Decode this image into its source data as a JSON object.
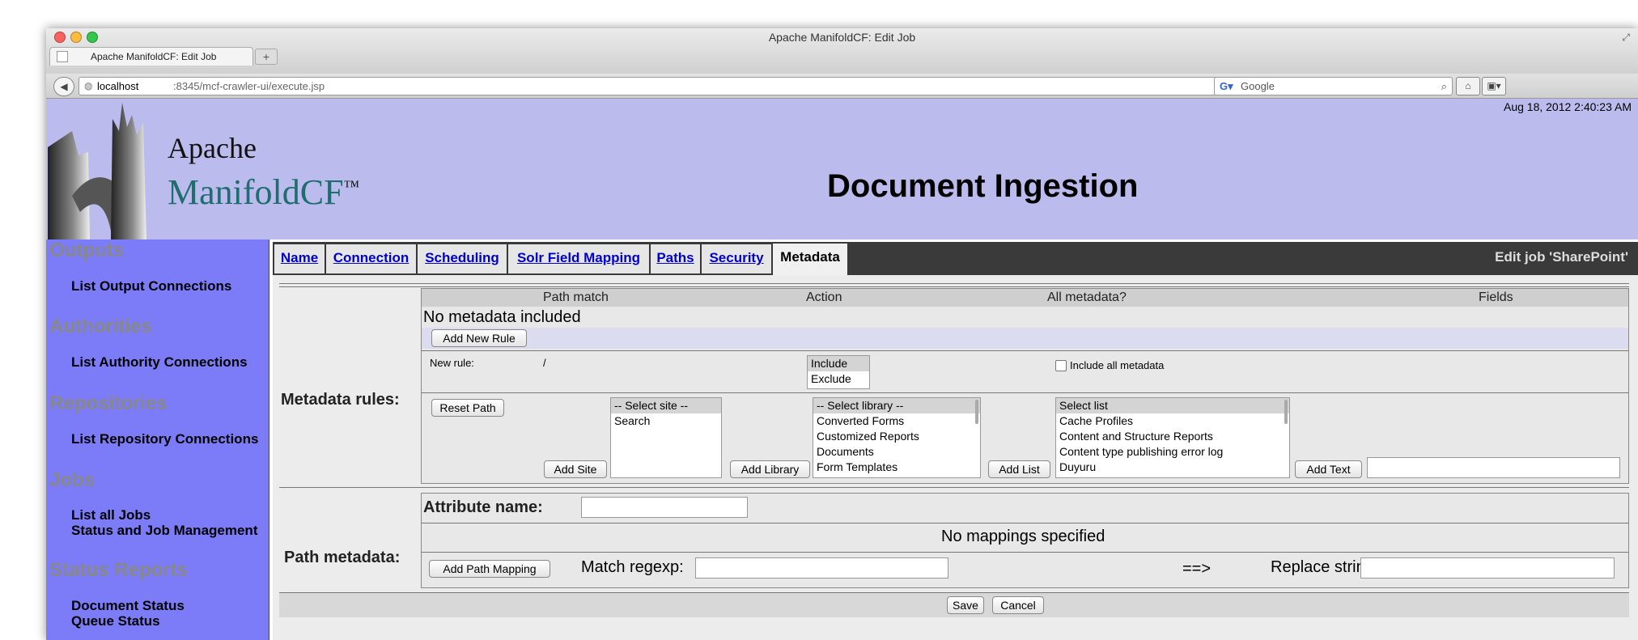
{
  "browser": {
    "window_title": "Apache ManifoldCF: Edit Job",
    "tab_title": "Apache ManifoldCF: Edit Job",
    "url_host": "localhost",
    "url_path": ":8345/mcf-crawler-ui/execute.jsp",
    "search_placeholder": "Google"
  },
  "header": {
    "logo_line1": "Apache",
    "logo_line2": "ManifoldCF",
    "logo_tm": "™",
    "datetime": "Aug 18, 2012 2:40:23 AM",
    "page_title": "Document Ingestion"
  },
  "sidebar": {
    "sections": [
      {
        "heading": "Outputs",
        "items": [
          "List Output Connections"
        ]
      },
      {
        "heading": "Authorities",
        "items": [
          "List Authority Connections"
        ]
      },
      {
        "heading": "Repositories",
        "items": [
          "List Repository Connections"
        ]
      },
      {
        "heading": "Jobs",
        "items": [
          "List all Jobs",
          "Status and Job Management"
        ]
      },
      {
        "heading": "Status Reports",
        "items": [
          "Document Status",
          "Queue Status"
        ]
      }
    ]
  },
  "job_tabs": [
    "Name",
    "Connection",
    "Scheduling",
    "Solr Field Mapping",
    "Paths",
    "Security",
    "Metadata"
  ],
  "active_tab": "Metadata",
  "edit_job_title": "Edit job 'SharePoint'",
  "metadata": {
    "section_label": "Metadata rules:",
    "columns": [
      "Path match",
      "Action",
      "All metadata?",
      "Fields"
    ],
    "empty_message": "No metadata included",
    "add_rule_label": "Add New Rule",
    "new_rule_label": "New rule:",
    "new_rule_path": "/",
    "action_options": [
      "Include",
      "Exclude"
    ],
    "include_all_label": "Include all metadata",
    "reset_path_label": "Reset Path",
    "site_options": [
      "-- Select site --",
      "Search"
    ],
    "add_site_label": "Add Site",
    "library_options": [
      "-- Select library --",
      "Converted Forms",
      "Customized Reports",
      "Documents",
      "Form Templates"
    ],
    "add_library_label": "Add Library",
    "list_options": [
      "Select list",
      "Cache Profiles",
      "Content and Structure Reports",
      "Content type publishing error log",
      "Duyuru"
    ],
    "add_list_label": "Add List",
    "add_text_label": "Add Text"
  },
  "path_metadata": {
    "section_label": "Path metadata:",
    "attribute_label": "Attribute name:",
    "no_mappings": "No mappings specified",
    "add_mapping_label": "Add Path Mapping",
    "match_label": "Match regexp:",
    "arrow": "==>",
    "replace_label": "Replace string:"
  },
  "buttons": {
    "save": "Save",
    "cancel": "Cancel"
  }
}
